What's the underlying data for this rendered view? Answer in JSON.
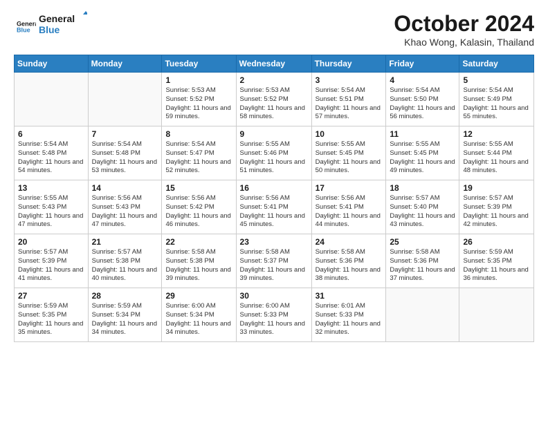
{
  "logo": {
    "line1": "General",
    "line2": "Blue"
  },
  "title": "October 2024",
  "location": "Khao Wong, Kalasin, Thailand",
  "headers": [
    "Sunday",
    "Monday",
    "Tuesday",
    "Wednesday",
    "Thursday",
    "Friday",
    "Saturday"
  ],
  "weeks": [
    [
      {
        "day": "",
        "info": ""
      },
      {
        "day": "",
        "info": ""
      },
      {
        "day": "1",
        "info": "Sunrise: 5:53 AM\nSunset: 5:52 PM\nDaylight: 11 hours and 59 minutes."
      },
      {
        "day": "2",
        "info": "Sunrise: 5:53 AM\nSunset: 5:52 PM\nDaylight: 11 hours and 58 minutes."
      },
      {
        "day": "3",
        "info": "Sunrise: 5:54 AM\nSunset: 5:51 PM\nDaylight: 11 hours and 57 minutes."
      },
      {
        "day": "4",
        "info": "Sunrise: 5:54 AM\nSunset: 5:50 PM\nDaylight: 11 hours and 56 minutes."
      },
      {
        "day": "5",
        "info": "Sunrise: 5:54 AM\nSunset: 5:49 PM\nDaylight: 11 hours and 55 minutes."
      }
    ],
    [
      {
        "day": "6",
        "info": "Sunrise: 5:54 AM\nSunset: 5:48 PM\nDaylight: 11 hours and 54 minutes."
      },
      {
        "day": "7",
        "info": "Sunrise: 5:54 AM\nSunset: 5:48 PM\nDaylight: 11 hours and 53 minutes."
      },
      {
        "day": "8",
        "info": "Sunrise: 5:54 AM\nSunset: 5:47 PM\nDaylight: 11 hours and 52 minutes."
      },
      {
        "day": "9",
        "info": "Sunrise: 5:55 AM\nSunset: 5:46 PM\nDaylight: 11 hours and 51 minutes."
      },
      {
        "day": "10",
        "info": "Sunrise: 5:55 AM\nSunset: 5:45 PM\nDaylight: 11 hours and 50 minutes."
      },
      {
        "day": "11",
        "info": "Sunrise: 5:55 AM\nSunset: 5:45 PM\nDaylight: 11 hours and 49 minutes."
      },
      {
        "day": "12",
        "info": "Sunrise: 5:55 AM\nSunset: 5:44 PM\nDaylight: 11 hours and 48 minutes."
      }
    ],
    [
      {
        "day": "13",
        "info": "Sunrise: 5:55 AM\nSunset: 5:43 PM\nDaylight: 11 hours and 47 minutes."
      },
      {
        "day": "14",
        "info": "Sunrise: 5:56 AM\nSunset: 5:43 PM\nDaylight: 11 hours and 47 minutes."
      },
      {
        "day": "15",
        "info": "Sunrise: 5:56 AM\nSunset: 5:42 PM\nDaylight: 11 hours and 46 minutes."
      },
      {
        "day": "16",
        "info": "Sunrise: 5:56 AM\nSunset: 5:41 PM\nDaylight: 11 hours and 45 minutes."
      },
      {
        "day": "17",
        "info": "Sunrise: 5:56 AM\nSunset: 5:41 PM\nDaylight: 11 hours and 44 minutes."
      },
      {
        "day": "18",
        "info": "Sunrise: 5:57 AM\nSunset: 5:40 PM\nDaylight: 11 hours and 43 minutes."
      },
      {
        "day": "19",
        "info": "Sunrise: 5:57 AM\nSunset: 5:39 PM\nDaylight: 11 hours and 42 minutes."
      }
    ],
    [
      {
        "day": "20",
        "info": "Sunrise: 5:57 AM\nSunset: 5:39 PM\nDaylight: 11 hours and 41 minutes."
      },
      {
        "day": "21",
        "info": "Sunrise: 5:57 AM\nSunset: 5:38 PM\nDaylight: 11 hours and 40 minutes."
      },
      {
        "day": "22",
        "info": "Sunrise: 5:58 AM\nSunset: 5:38 PM\nDaylight: 11 hours and 39 minutes."
      },
      {
        "day": "23",
        "info": "Sunrise: 5:58 AM\nSunset: 5:37 PM\nDaylight: 11 hours and 39 minutes."
      },
      {
        "day": "24",
        "info": "Sunrise: 5:58 AM\nSunset: 5:36 PM\nDaylight: 11 hours and 38 minutes."
      },
      {
        "day": "25",
        "info": "Sunrise: 5:58 AM\nSunset: 5:36 PM\nDaylight: 11 hours and 37 minutes."
      },
      {
        "day": "26",
        "info": "Sunrise: 5:59 AM\nSunset: 5:35 PM\nDaylight: 11 hours and 36 minutes."
      }
    ],
    [
      {
        "day": "27",
        "info": "Sunrise: 5:59 AM\nSunset: 5:35 PM\nDaylight: 11 hours and 35 minutes."
      },
      {
        "day": "28",
        "info": "Sunrise: 5:59 AM\nSunset: 5:34 PM\nDaylight: 11 hours and 34 minutes."
      },
      {
        "day": "29",
        "info": "Sunrise: 6:00 AM\nSunset: 5:34 PM\nDaylight: 11 hours and 34 minutes."
      },
      {
        "day": "30",
        "info": "Sunrise: 6:00 AM\nSunset: 5:33 PM\nDaylight: 11 hours and 33 minutes."
      },
      {
        "day": "31",
        "info": "Sunrise: 6:01 AM\nSunset: 5:33 PM\nDaylight: 11 hours and 32 minutes."
      },
      {
        "day": "",
        "info": ""
      },
      {
        "day": "",
        "info": ""
      }
    ]
  ]
}
